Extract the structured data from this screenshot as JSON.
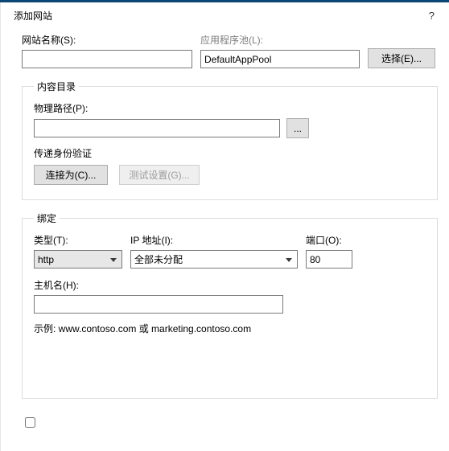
{
  "title": "添加网站",
  "help_icon": "?",
  "site_name_label": "网站名称(S):",
  "site_name_value": "",
  "app_pool_label": "应用程序池(L):",
  "app_pool_value": "DefaultAppPool",
  "select_button": "选择(E)...",
  "content_group": {
    "legend": "内容目录",
    "physical_path_label": "物理路径(P):",
    "physical_path_value": "",
    "browse_button": "...",
    "passthrough_label": "传递身份验证",
    "connect_as_button": "连接为(C)...",
    "test_settings_button": "测试设置(G)..."
  },
  "binding_group": {
    "legend": "绑定",
    "type_label": "类型(T):",
    "type_value": "http",
    "ip_label": "IP 地址(I):",
    "ip_value": "全部未分配",
    "port_label": "端口(O):",
    "port_value": "80",
    "hostname_label": "主机名(H):",
    "hostname_value": "",
    "hint": "示例: www.contoso.com 或 marketing.contoso.com"
  }
}
